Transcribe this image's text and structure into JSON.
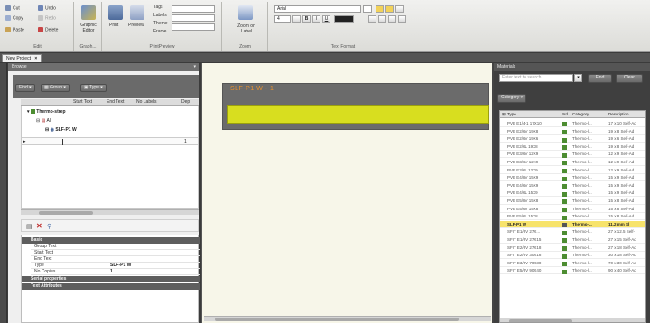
{
  "ribbon": {
    "edit": {
      "label": "Edit",
      "cut": "Cut",
      "undo": "Undo",
      "copy": "Copy",
      "redo": "Redo",
      "paste": "Paste",
      "delete": "Delete"
    },
    "graphic": {
      "label": "Graph...",
      "graphic_editor": "Graphic Editor"
    },
    "print": {
      "label": "PrintPreview",
      "print": "Print",
      "preview": "Preview",
      "tags": "Tags",
      "labels": "Labels",
      "theme": "Theme",
      "frame": "Frame"
    },
    "zoom": {
      "label": "Zoom",
      "zoom_label": "Zoom on Label"
    },
    "text_format": {
      "label": "Text Format",
      "font_value": "Arial",
      "size_value": "4",
      "bold": "B",
      "italic": "I",
      "underline": "U"
    }
  },
  "document_tab": "New Project",
  "left_panel": {
    "title": "Browse",
    "toolbar": {
      "find": "Find",
      "group": "Group",
      "type": "Type"
    },
    "columns": [
      "Start Text",
      "End Text",
      "No Labels",
      "Dep"
    ],
    "tree": [
      {
        "label": "Thermo-strep",
        "level": 0
      },
      {
        "label": "All",
        "level": 1
      },
      {
        "label": "SLF-P1 W",
        "level": 2
      }
    ],
    "count_value": "1",
    "properties": {
      "sections": [
        {
          "title": "Basic",
          "rows": [
            {
              "name": "Group Text",
              "value": ""
            },
            {
              "name": "Start Text",
              "value": ""
            },
            {
              "name": "End Text",
              "value": ""
            },
            {
              "name": "Type",
              "value": "SLF-P1 W"
            },
            {
              "name": "No.Copies",
              "value": "1"
            }
          ]
        },
        {
          "title": "Serial properties",
          "rows": []
        },
        {
          "title": "Text Attributes",
          "rows": []
        }
      ]
    }
  },
  "canvas": {
    "label_name": "SLF-P1 W - 1"
  },
  "right_panel": {
    "title": "Materials",
    "search_placeholder": "Enter text to search...",
    "find_button": "Find",
    "clear_button": "Clear",
    "category_button": "Category",
    "columns": [
      "Type",
      "Brd",
      "Category",
      "Description"
    ],
    "rows": [
      {
        "type": "PVE E1/4-1 17X10",
        "category": "Thermo-l...",
        "desc": "17 x 10 Self-Ad",
        "selected": false
      },
      {
        "type": "PVE E2/6V 19X8",
        "category": "Thermo-l...",
        "desc": "19 x 8 Self-Ad",
        "selected": false
      },
      {
        "type": "PVE E2/6V 19X6",
        "category": "Thermo-l...",
        "desc": "19 x 6 Self-Ad",
        "selected": false
      },
      {
        "type": "PVE E2/6L 19X8",
        "category": "Thermo-l...",
        "desc": "19 x 8 Self-Ad",
        "selected": false
      },
      {
        "type": "PVE E3/6V 12X9",
        "category": "Thermo-l...",
        "desc": "12 x 9 Self-Ad",
        "selected": false
      },
      {
        "type": "PVE E3/6V 12X9",
        "category": "Thermo-l...",
        "desc": "12 x 9 Self-Ad",
        "selected": false
      },
      {
        "type": "PVE E3/6L 12X9",
        "category": "Thermo-l...",
        "desc": "12 x 9 Self-Ad",
        "selected": false
      },
      {
        "type": "PVE E4/8V 15X9",
        "category": "Thermo-l...",
        "desc": "15 x 9 Self-Ad",
        "selected": false
      },
      {
        "type": "PVE E4/6V 15X9",
        "category": "Thermo-l...",
        "desc": "15 x 9 Self-Ad",
        "selected": false
      },
      {
        "type": "PVE E4/6L 15X9",
        "category": "Thermo-l...",
        "desc": "15 x 9 Self-Ad",
        "selected": false
      },
      {
        "type": "PVE E5/8V 15X8",
        "category": "Thermo-l...",
        "desc": "15 x 8 Self-Ad",
        "selected": false
      },
      {
        "type": "PVE E5/6V 15X8",
        "category": "Thermo-l...",
        "desc": "15 x 8 Self-Ad",
        "selected": false
      },
      {
        "type": "PVE E5/6L 15X8",
        "category": "Thermo-l...",
        "desc": "15 x 8 Self-Ad",
        "selected": false
      },
      {
        "type": "SLF-P1 W",
        "category": "Thermo-...",
        "desc": "11.2 mm Sl",
        "selected": true
      },
      {
        "type": "SFIT E1/6V 27X...",
        "category": "Thermo-l...",
        "desc": "27 x 12.5 Self-",
        "selected": false
      },
      {
        "type": "SFIT E1/6V 27X15",
        "category": "Thermo-l...",
        "desc": "27 x 15 Self-Ad",
        "selected": false
      },
      {
        "type": "SFIT E2/6V 27X18",
        "category": "Thermo-l...",
        "desc": "27 x 18 Self-Ad",
        "selected": false
      },
      {
        "type": "SFIT E2/6V 30X18",
        "category": "Thermo-l...",
        "desc": "30 x 18 Self-Ad",
        "selected": false
      },
      {
        "type": "SFIT E3/6V 70X30",
        "category": "Thermo-l...",
        "desc": "70 x 30 Self-Ad",
        "selected": false
      },
      {
        "type": "SFIT E5/6V 90X40",
        "category": "Thermo-l...",
        "desc": "90 x 40 Self-Ad",
        "selected": false
      }
    ]
  },
  "colors": {
    "accent_yellow": "#d8de1f",
    "label_title_orange": "#e8912f",
    "selected_row": "#f7e36b",
    "brand_green": "#4d8d32"
  }
}
